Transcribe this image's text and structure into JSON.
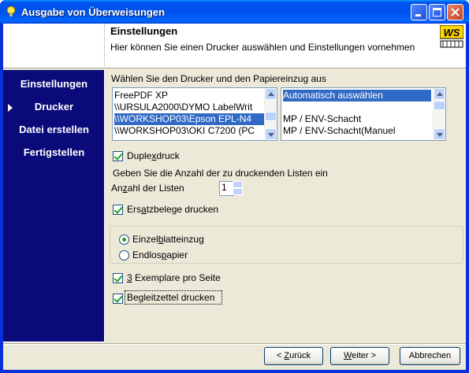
{
  "window": {
    "title": "Ausgabe von Überweisungen",
    "accent": "#0054e3"
  },
  "header": {
    "title": "Einstellungen",
    "description": "Hier können Sie einen Drucker auswählen und Einstellungen vornehmen",
    "logo_text": "WS"
  },
  "nav": {
    "items": [
      {
        "label": "Einstellungen"
      },
      {
        "label": "Drucker",
        "active": true
      },
      {
        "label": "Datei erstellen"
      },
      {
        "label": "Fertigstellen"
      }
    ]
  },
  "printer_section": {
    "label": "Wählen Sie den Drucker und den Papiereinzug aus",
    "printers": [
      "FreePDF XP",
      "\\\\URSULA2000\\DYMO LabelWrit",
      "\\\\WORKSHOP03\\Epson EPL-N4",
      "\\\\WORKSHOP03\\OKI C7200 (PC"
    ],
    "selected_printer_index": 2,
    "trays": [
      "Automatisch auswählen",
      "",
      "MP / ENV-Schacht",
      "MP / ENV-Schacht(Manuel"
    ],
    "selected_tray_index": 0
  },
  "options": {
    "duplex_pre": "Duple",
    "duplex_u": "x",
    "duplex_post": "druck",
    "duplex_checked": true,
    "count_prompt": "Geben Sie die Anzahl der zu druckenden Listen ein",
    "count_label_pre": "An",
    "count_label_u": "z",
    "count_label_post": "ahl der Listen",
    "count_value": "1",
    "substitute_pre": "Ers",
    "substitute_u": "a",
    "substitute_post": "tzbelege drucken",
    "substitute_checked": true,
    "feed_single_pre": "Einzel",
    "feed_single_u": "b",
    "feed_single_post": "latteinzug",
    "feed_single_checked": true,
    "feed_continuous_pre": "Endlos",
    "feed_continuous_u": "p",
    "feed_continuous_post": "apier",
    "feed_continuous_checked": false,
    "copies_u": "3",
    "copies_post": " Exemplare pro Seite",
    "copies_checked": true,
    "cover_label": "Begleitzettel drucken",
    "cover_checked": true
  },
  "footer": {
    "back_pre": "< ",
    "back_u": "Z",
    "back_post": "urück",
    "next_pre": "",
    "next_u": "W",
    "next_post": "eiter >",
    "cancel_label": "Abbrechen"
  }
}
